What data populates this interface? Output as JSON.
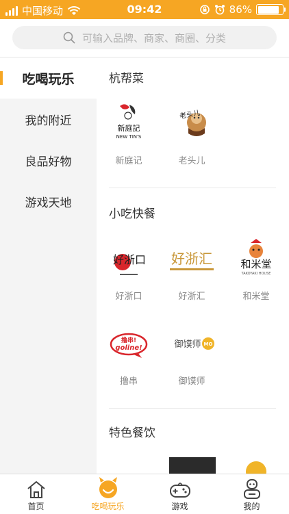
{
  "status_bar": {
    "carrier": "中国移动",
    "time": "09:42",
    "battery": "86%",
    "battery_level": 0.86
  },
  "search": {
    "placeholder": "可输入品牌、商家、商圈、分类"
  },
  "sidebar": {
    "items": [
      {
        "label": "吃喝玩乐",
        "active": true
      },
      {
        "label": "我的附近",
        "active": false
      },
      {
        "label": "良品好物",
        "active": false
      },
      {
        "label": "游戏天地",
        "active": false
      }
    ]
  },
  "sections": [
    {
      "title": "杭帮菜",
      "brands": [
        {
          "name": "新庭记",
          "logo_text": "新庭記",
          "logo_sub": "NEW TIN'S"
        },
        {
          "name": "老头儿",
          "logo_text": "老头儿"
        }
      ]
    },
    {
      "title": "小吃快餐",
      "brands": [
        {
          "name": "好浙口",
          "logo_text": "好浙口"
        },
        {
          "name": "好浙汇",
          "logo_text": "好浙汇"
        },
        {
          "name": "和米堂",
          "logo_text": "和米堂",
          "logo_sub": "TAKOYAKI HOUSE"
        },
        {
          "name": "撸串",
          "logo_text": "撸串!",
          "logo_sub": "goline!"
        },
        {
          "name": "御馍师",
          "logo_text": "御馍师",
          "logo_sub": "MO"
        }
      ]
    },
    {
      "title": "特色餐饮",
      "brands": []
    }
  ],
  "tabbar": {
    "items": [
      {
        "label": "首页",
        "icon": "home-icon",
        "active": false
      },
      {
        "label": "吃喝玩乐",
        "icon": "devil-smile-icon",
        "active": true
      },
      {
        "label": "游戏",
        "icon": "gamepad-icon",
        "active": false
      },
      {
        "label": "我的",
        "icon": "profile-icon",
        "active": false
      }
    ]
  },
  "colors": {
    "accent": "#f6a623",
    "sidebar_bg": "#f4f4f4",
    "logo_red": "#d9262c"
  }
}
